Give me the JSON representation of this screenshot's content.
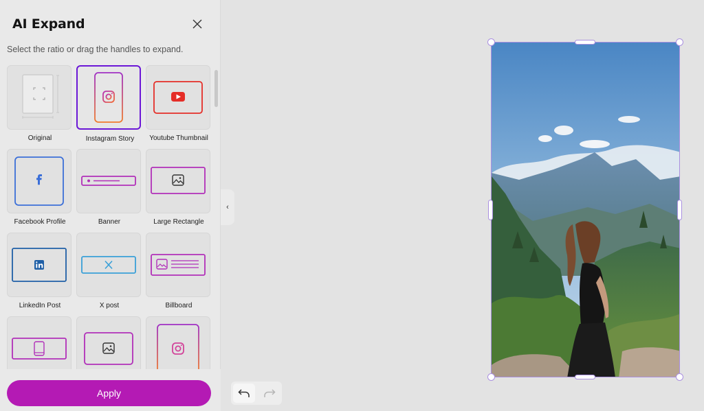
{
  "panel": {
    "title": "AI Expand",
    "subtitle": "Select the ratio or drag the handles to expand.",
    "apply_label": "Apply"
  },
  "presets": [
    {
      "label": "Original",
      "icon": "original-frame-icon",
      "selected": false
    },
    {
      "label": "Instagram Story",
      "icon": "instagram-icon",
      "selected": true
    },
    {
      "label": "Youtube Thumbnail",
      "icon": "youtube-icon",
      "selected": false
    },
    {
      "label": "Facebook Profile",
      "icon": "facebook-icon",
      "selected": false
    },
    {
      "label": "Banner",
      "icon": "banner-icon",
      "selected": false
    },
    {
      "label": "Large Rectangle",
      "icon": "image-icon",
      "selected": false
    },
    {
      "label": "LinkedIn Post",
      "icon": "linkedin-icon",
      "selected": false
    },
    {
      "label": "X post",
      "icon": "x-icon",
      "selected": false
    },
    {
      "label": "Billboard",
      "icon": "billboard-icon",
      "selected": false
    },
    {
      "label": "",
      "icon": "phone-landscape-icon",
      "selected": false
    },
    {
      "label": "",
      "icon": "image-icon",
      "selected": false
    },
    {
      "label": "",
      "icon": "instagram-icon",
      "selected": false
    }
  ],
  "colors": {
    "accent": "#b41ab4",
    "selected_border": "#6a16d6",
    "handle": "#a98fe0",
    "youtube": "#e52d27",
    "facebook": "#3b6fd8",
    "linkedin": "#1f5fa6",
    "x": "#3aa0d8",
    "magenta": "#b12fb9"
  }
}
